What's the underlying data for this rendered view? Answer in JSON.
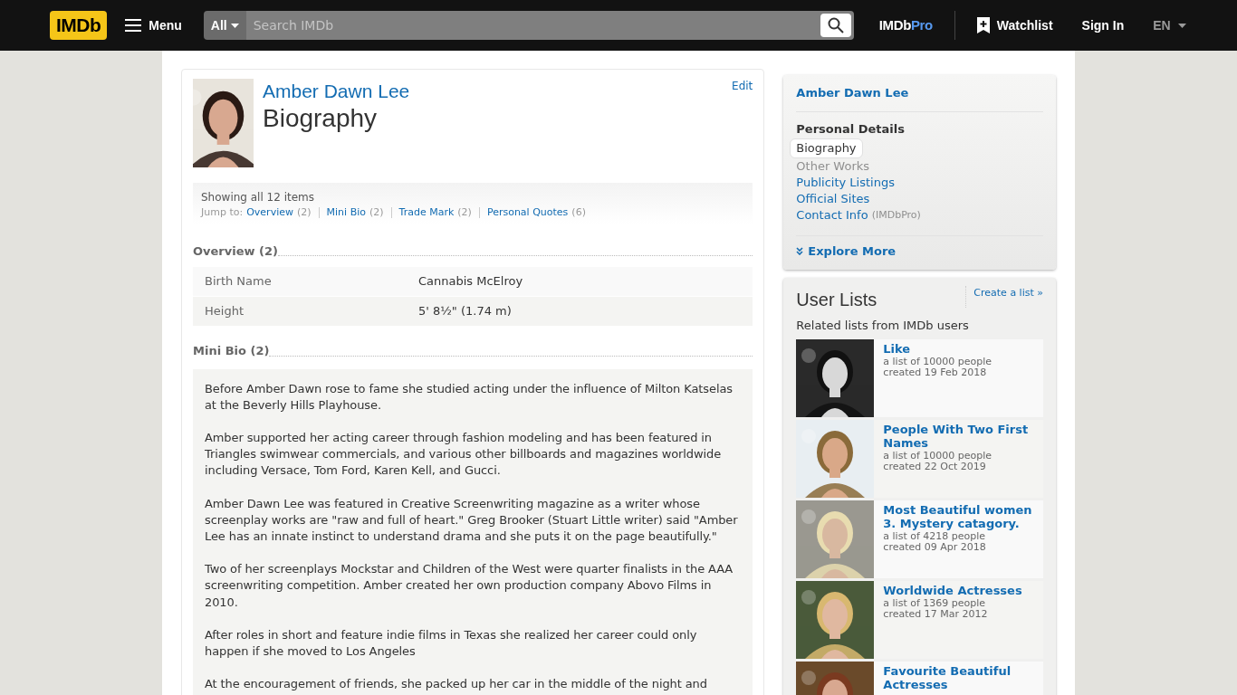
{
  "header": {
    "logo": "IMDb",
    "menu": "Menu",
    "search_scope": "All",
    "search_placeholder": "Search IMDb",
    "pro_logo": {
      "main": "IMDb",
      "accent": "Pro"
    },
    "watchlist": "Watchlist",
    "sign_in": "Sign In",
    "language": "EN"
  },
  "main": {
    "edit": "Edit",
    "name": "Amber Dawn Lee",
    "title": "Biography",
    "showing": "Showing all 12 items",
    "jump_label": "Jump to:",
    "jump_links": [
      {
        "label": "Overview",
        "count": "(2)"
      },
      {
        "label": "Mini Bio",
        "count": "(2)"
      },
      {
        "label": "Trade Mark",
        "count": "(2)"
      },
      {
        "label": "Personal Quotes",
        "count": "(6)"
      }
    ],
    "overview": {
      "heading": "Overview (2)",
      "rows": [
        {
          "label": "Birth Name",
          "value": "Cannabis McElroy"
        },
        {
          "label": "Height",
          "value": "5' 8½\" (1.74 m)"
        }
      ]
    },
    "mini_bio": {
      "heading": "Mini Bio (2)",
      "paragraphs": [
        "Before Amber Dawn rose to fame she studied acting under the influence of Milton Katselas at the Beverly Hills Playhouse.",
        "Amber supported her acting career through fashion modeling and has been featured in Triangles swimwear commercials, and various other billboards and magazines worldwide including Versace, Tom Ford, Karen Kell, and Gucci.",
        "Amber Dawn Lee was featured in Creative Screenwriting magazine as a writer whose screenplay works are \"raw and full of heart.\" Greg Brooker (Stuart Little writer) said \"Amber Lee has an innate instinct to understand drama and she puts it on the page beautifully.\"",
        "Two of her screenplays Mockstar and Children of the West were quarter finalists in the AAA screenwriting competition. Amber created her own production company Abovo Films in 2010.",
        "After roles in short and feature indie films in Texas she realized her career could only happen if she moved to Los Angeles",
        "At the encouragement of friends, she packed up her car in the middle of the night and"
      ]
    }
  },
  "sidebar": {
    "name": "Amber Dawn Lee",
    "section": "Personal Details",
    "links": [
      {
        "label": "Biography",
        "selected": true,
        "disabled": false
      },
      {
        "label": "Other Works",
        "selected": false,
        "disabled": true
      },
      {
        "label": "Publicity Listings",
        "selected": false,
        "disabled": false
      },
      {
        "label": "Official Sites",
        "selected": false,
        "disabled": false
      },
      {
        "label": "Contact Info",
        "note": "(IMDbPro)",
        "selected": false,
        "disabled": false
      }
    ],
    "explore": "Explore More",
    "user_lists": {
      "title": "User Lists",
      "create": "Create a list »",
      "subtitle": "Related lists from IMDb users",
      "lists": [
        {
          "title": "Like",
          "size": "a list of 10000 people",
          "created": "created 19 Feb 2018"
        },
        {
          "title": "People With Two First Names",
          "size": "a list of 10000 people",
          "created": "created 22 Oct 2019"
        },
        {
          "title": "Most Beautiful women 3. Mystery catagory.",
          "size": "a list of 4218 people",
          "created": "created 09 Apr 2018"
        },
        {
          "title": "Worldwide Actresses",
          "size": "a list of 1369 people",
          "created": "created 17 Mar 2012"
        },
        {
          "title": "Favourite Beautiful Actresses"
        }
      ]
    }
  }
}
